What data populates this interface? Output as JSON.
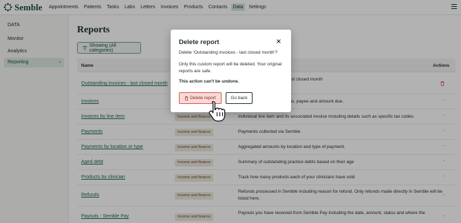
{
  "app": {
    "brand": "Semble",
    "nav": [
      "Appointments",
      "Patients",
      "Tasks",
      "Labs",
      "Letters",
      "Invoices",
      "Products",
      "Contacts",
      "Data",
      "Settings"
    ],
    "active_nav": "Data"
  },
  "sidebar": {
    "section": "DATA",
    "items": [
      {
        "label": "Monitor",
        "active": false
      },
      {
        "label": "Analytics",
        "active": false
      },
      {
        "label": "Reporting",
        "active": true
      }
    ],
    "chevron": "‹"
  },
  "main": {
    "title": "Reports",
    "filter_label": "Showing (All categories)",
    "columns": {
      "name": "Name",
      "actions": "Actions"
    },
    "rows": [
      {
        "name": "Outstanding invoices - last closed month",
        "category": "",
        "desc": "ing balance raised in the last closed month\non 16/04/2026.",
        "action": "trash"
      },
      {
        "name": "Invoices",
        "category": "",
        "desc": "eframe including their status, payee and amount due.",
        "action": "-"
      },
      {
        "name": "Invoices by line item",
        "category": "Income and finance",
        "desc": "Individual line item and its associated invoice including details such as specific tax codes.",
        "action": "-"
      },
      {
        "name": "Payments",
        "category": "Income and finance",
        "desc": "Payments collected via Semble.",
        "action": "-"
      },
      {
        "name": "Payments by location or type",
        "category": "Income and finance",
        "desc": "Aggregated amounts by location and type of payment.",
        "action": "-"
      },
      {
        "name": "Aged debt",
        "category": "Income and finance",
        "desc": "Summary of outstanding practice debts based on their age",
        "action": "-"
      },
      {
        "name": "Products by clinician",
        "category": "Income and finance",
        "desc": "Track how many products each of your clinicians have sold",
        "action": "-"
      },
      {
        "name": "Refunds",
        "category": "Income and finance",
        "desc": "Refunds processed in Semble including reason for refund. Only refunds made directly in Semble will be listed here.",
        "action": "-"
      },
      {
        "name": "Payouts - Semble Pay",
        "category": "Income and finance",
        "desc": "Payouts you have received from Semble Pay including the date, amount, status and where the",
        "action": "-"
      }
    ]
  },
  "modal": {
    "title": "Delete report",
    "question": "Delete 'Outstanding invoices - last closed month'?",
    "info": "Only this custom report will be deleted. Your original reports are safe.",
    "warning": "This action can't be undone.",
    "delete_label": "Delete report",
    "back_label": "Go back"
  },
  "colors": {
    "brand": "#1f4e43",
    "danger": "#d9534a",
    "tag_bg": "#f0e8dc"
  },
  "icons": [
    "semble-logo-icon",
    "menu-icon",
    "filter-icon",
    "chevron-left-icon",
    "trash-icon",
    "close-icon",
    "hand-pointer-icon"
  ]
}
